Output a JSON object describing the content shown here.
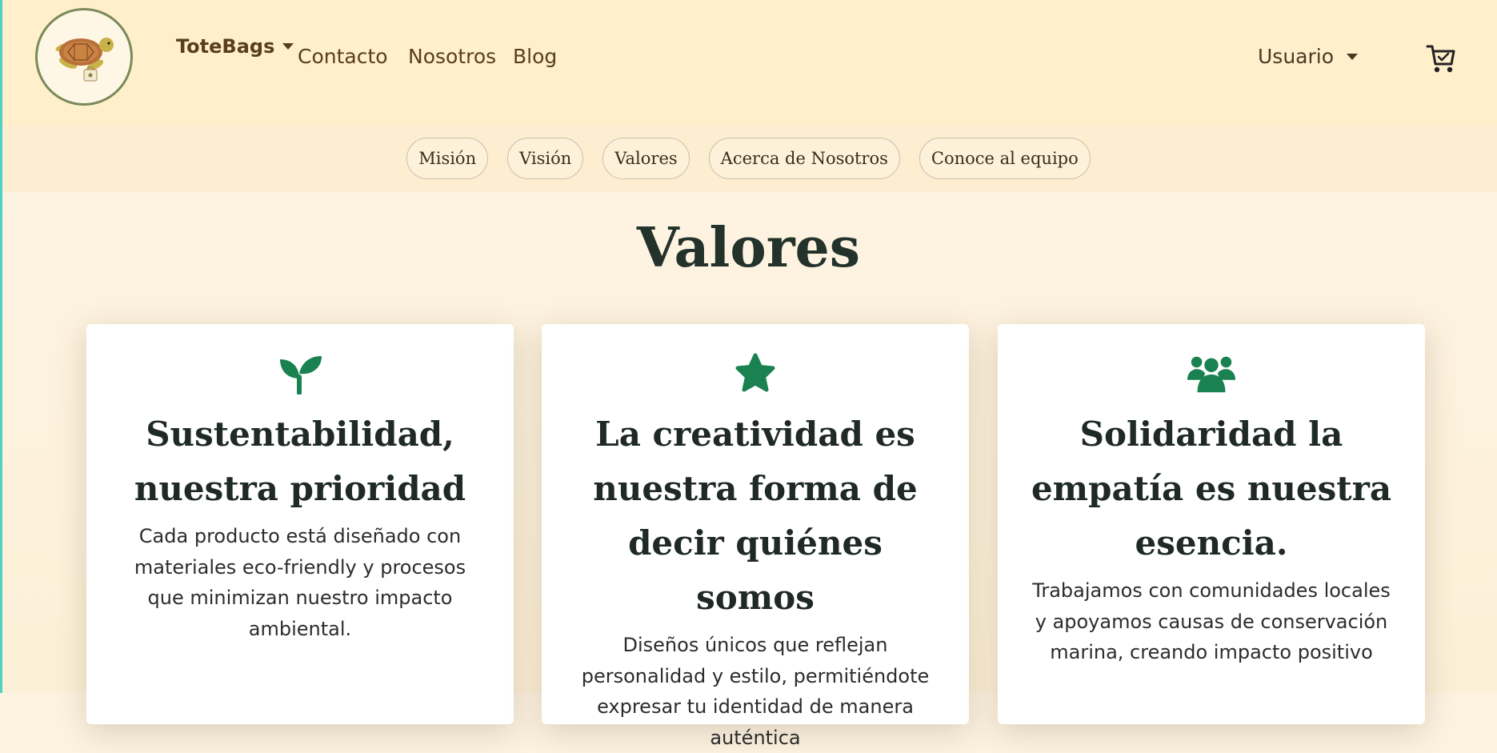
{
  "navbar": {
    "brand": "ToteBags",
    "links": [
      "Contacto",
      "Nosotros",
      "Blog"
    ],
    "user_menu": "Usuario",
    "logo_icon": "turtle-tote-logo-icon",
    "cart_icon": "shopping-cart-icon"
  },
  "subnav": {
    "items": [
      "Misión",
      "Visión",
      "Valores",
      "Acerca de Nosotros",
      "Conoce al equipo"
    ]
  },
  "page": {
    "title": "Valores"
  },
  "cards": [
    {
      "icon": "seedling-icon",
      "title": "Sustentabilidad, nuestra prioridad",
      "text": "Cada producto está diseñado con materiales eco-friendly y procesos que minimizan nuestro impacto ambiental."
    },
    {
      "icon": "star-icon",
      "title": "La creatividad es nuestra forma de decir quiénes somos",
      "text": "Diseños únicos que reflejan personalidad y estilo, permitiéndote expresar tu identidad de manera auténtica"
    },
    {
      "icon": "people-group-icon",
      "title": "Solidaridad la empatía es nuestra esencia.",
      "text": "Trabajamos con comunidades locales y apoyamos causas de conservación marina, creando impacto positivo"
    }
  ],
  "colors": {
    "navbar_bg": "#ffefcb",
    "subnav_bg": "#fdeed2",
    "brand_text": "#5a3e1b",
    "icon_green": "#1a8150",
    "title_dark": "#23322a"
  }
}
